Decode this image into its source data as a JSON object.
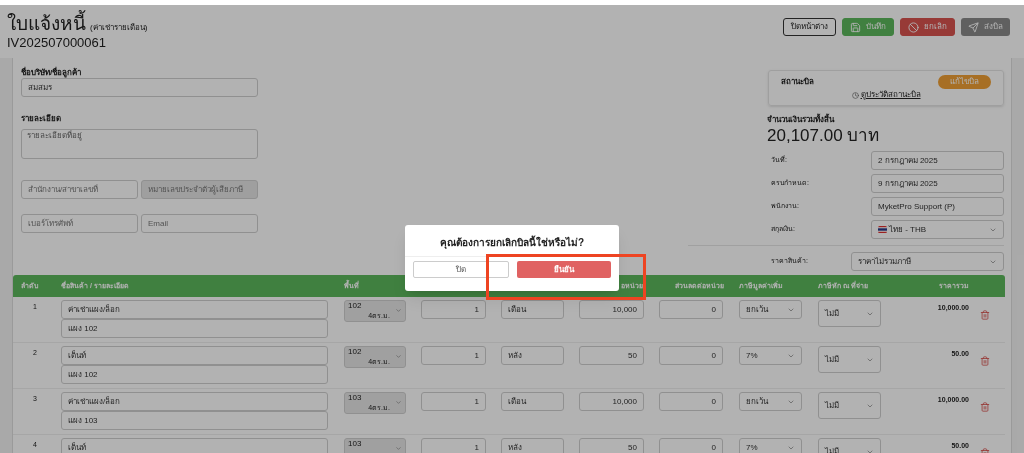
{
  "header": {
    "title": "ใบแจ้งหนี้",
    "subtitle": "(ค่าเช่ารายเดือน)",
    "doc_no": "IV202507000061",
    "buttons": [
      {
        "label": "ปิดหน้าต่าง",
        "kind": "outline",
        "disabled": false
      },
      {
        "label": "บันทึก",
        "kind": "save",
        "disabled": false
      },
      {
        "label": "ยกเลิก",
        "kind": "cancel",
        "disabled": false
      },
      {
        "label": "ส่งบิล",
        "kind": "send",
        "disabled": true
      }
    ]
  },
  "customer": {
    "label": "ชื่อบริษัท/ชื่อลูกค้า",
    "value": "สมสมร"
  },
  "details": {
    "label": "รายละเอียด",
    "address_label": "รายละเอียดที่อยู่",
    "fields": [
      {
        "placeholder": "สำนักงาน/สาขาเลขที่",
        "disabled": false
      },
      {
        "placeholder": "หมายเลขประจำตัวผู้เสียภาษี",
        "disabled": true
      },
      {
        "placeholder": "เบอร์โทรศัพท์",
        "disabled": false
      },
      {
        "placeholder": "Email",
        "disabled": false
      }
    ]
  },
  "status": {
    "label": "สถานะบิล",
    "badge": "แก้ไขบิล",
    "history_link": "ดูประวัติสถานะบิล"
  },
  "total": {
    "label": "จำนวนเงินรวมทั้งสิ้น",
    "amount": "20,107.00 บาท"
  },
  "info_fields": [
    {
      "label": "วันที่:",
      "value": "2 กรกฎาคม 2025",
      "kind": "text"
    },
    {
      "label": "ครบกำหนด:",
      "value": "9 กรกฎาคม 2025",
      "kind": "text"
    },
    {
      "label": "พนักงาน:",
      "value": "MyketPro Support (P)",
      "kind": "text"
    },
    {
      "label": "สกุลเงิน:",
      "value": "ไทย - THB",
      "kind": "currency"
    }
  ],
  "price_type": {
    "label": "ราคาสินค้า:",
    "value": "ราคาไม่รวมภาษี"
  },
  "table": {
    "columns": [
      {
        "kind": "label",
        "label": "ลำดับ"
      },
      {
        "kind": "label",
        "label": "ชื่อสินค้า / รายละเอียด"
      },
      {
        "kind": "label",
        "label": "พื้นที่"
      },
      {
        "kind": "covered"
      },
      {
        "kind": "covered"
      },
      {
        "kind": "label",
        "label": "อหน่วย"
      },
      {
        "kind": "label",
        "label": "ส่วนลดต่อหน่วย"
      },
      {
        "kind": "label",
        "label": "ภาษีมูลค่าเพิ่ม"
      },
      {
        "kind": "label",
        "label": "ภาษีหัก ณ ที่จ่าย"
      },
      {
        "kind": "label",
        "label": "ราคารวม"
      }
    ],
    "rows": [
      {
        "no": "1",
        "name": "ค่าเช่าแผง/ล็อก",
        "detail": "แผง 102",
        "area": "102",
        "area_size": "4ตร.ม.",
        "qty": "1",
        "unit": "เดือน",
        "price": "10,000",
        "discount": "0",
        "vat": "ยกเว้น",
        "wht": "ไม่มี",
        "total": "10,000.00"
      },
      {
        "no": "2",
        "name": "เต็นท์",
        "detail": "แผง 102",
        "area": "102",
        "area_size": "4ตร.ม.",
        "qty": "1",
        "unit": "หลัง",
        "price": "50",
        "discount": "0",
        "vat": "7%",
        "wht": "ไม่มี",
        "total": "50.00"
      },
      {
        "no": "3",
        "name": "ค่าเช่าแผง/ล็อก",
        "detail": "แผง 103",
        "area": "103",
        "area_size": "4ตร.ม.",
        "qty": "1",
        "unit": "เดือน",
        "price": "10,000",
        "discount": "0",
        "vat": "ยกเว้น",
        "wht": "ไม่มี",
        "total": "10,000.00"
      },
      {
        "no": "4",
        "name": "เต็นท์",
        "area": "103",
        "qty": "1",
        "unit": "หลัง",
        "price": "50",
        "discount": "0",
        "vat": "7%",
        "wht": "ไม่มี",
        "total": "50.00"
      }
    ]
  },
  "dialog": {
    "title": "คุณต้องการยกเลิกบิลนี้ใช่หรือไม่?",
    "buttons": [
      {
        "label": "ปิด",
        "kind": "close",
        "highlighted": false
      },
      {
        "label": "ยืนยัน",
        "kind": "confirm",
        "highlighted": true
      }
    ]
  }
}
